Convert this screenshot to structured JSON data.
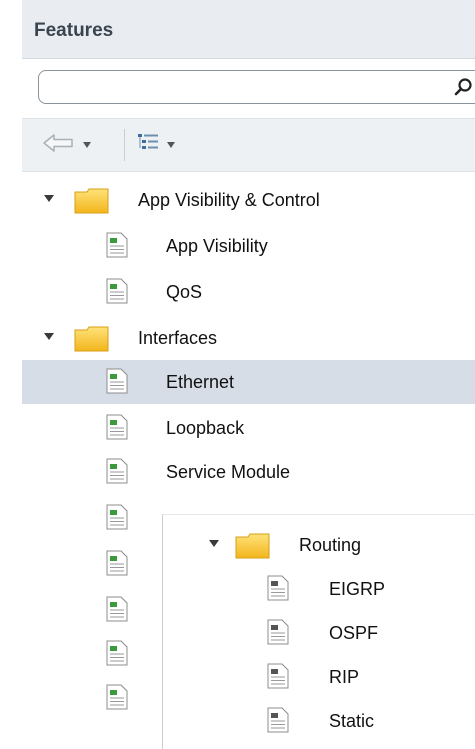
{
  "panel": {
    "title": "Features"
  },
  "search": {
    "value": "",
    "placeholder": "",
    "icon": "search-icon"
  },
  "toolbar": {
    "back_icon": "back-arrow-icon",
    "tree_icon": "tree-view-icon"
  },
  "tree": {
    "group1": {
      "label": "App Visibility & Control",
      "items": [
        {
          "label": "App Visibility"
        },
        {
          "label": "QoS"
        }
      ]
    },
    "group2": {
      "label": "Interfaces",
      "items": [
        {
          "label": "Ethernet",
          "selected": true
        },
        {
          "label": "Loopback"
        },
        {
          "label": "Service Module"
        }
      ]
    }
  },
  "overlay": {
    "group": {
      "label": "Routing",
      "items": [
        {
          "label": "EIGRP"
        },
        {
          "label": "OSPF"
        },
        {
          "label": "RIP"
        },
        {
          "label": "Static"
        }
      ]
    }
  },
  "colors": {
    "header_bg": "#e9edf1",
    "selected_row": "#d6dde6",
    "folder": "#f5c431"
  }
}
